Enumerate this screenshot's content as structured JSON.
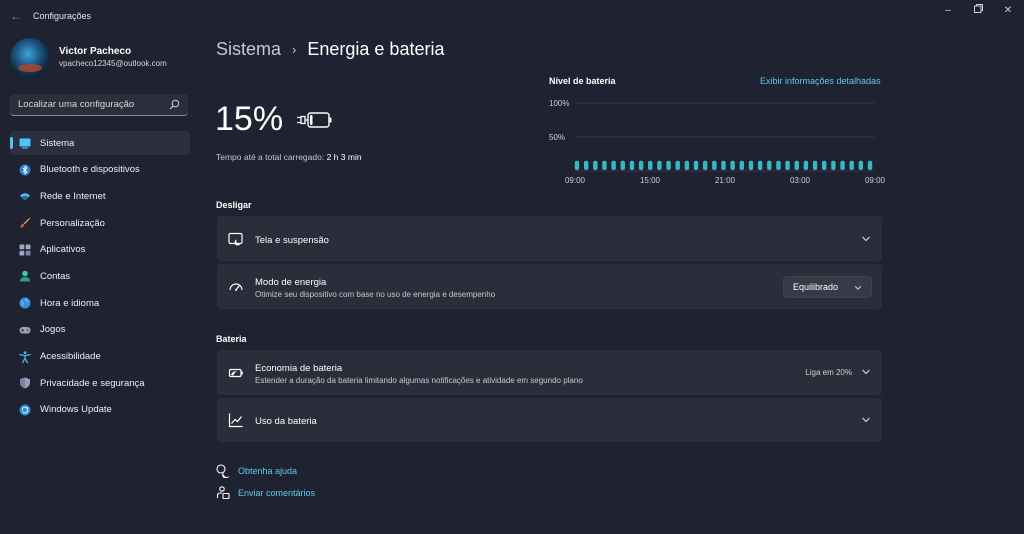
{
  "window": {
    "title": "Configurações",
    "back_icon": "back-arrow-icon",
    "minimize_icon": "minimize-icon",
    "restore_icon": "restore-icon",
    "close_icon": "close-icon"
  },
  "user": {
    "name": "Victor Pacheco",
    "email": "vpacheco12345@outlook.com"
  },
  "search": {
    "placeholder": "Localizar uma configuração",
    "icon": "search-icon"
  },
  "sidebar": {
    "items": [
      {
        "label": "Sistema",
        "icon": "monitor-icon",
        "active": true
      },
      {
        "label": "Bluetooth e dispositivos",
        "icon": "bluetooth-icon",
        "active": false
      },
      {
        "label": "Rede e Internet",
        "icon": "wifi-icon",
        "active": false
      },
      {
        "label": "Personalização",
        "icon": "brush-icon",
        "active": false
      },
      {
        "label": "Aplicativos",
        "icon": "apps-icon",
        "active": false
      },
      {
        "label": "Contas",
        "icon": "person-icon",
        "active": false
      },
      {
        "label": "Hora e idioma",
        "icon": "globe-clock-icon",
        "active": false
      },
      {
        "label": "Jogos",
        "icon": "gamepad-icon",
        "active": false
      },
      {
        "label": "Acessibilidade",
        "icon": "accessibility-icon",
        "active": false
      },
      {
        "label": "Privacidade e segurança",
        "icon": "shield-icon",
        "active": false
      },
      {
        "label": "Windows Update",
        "icon": "update-icon",
        "active": false
      }
    ]
  },
  "breadcrumb": {
    "parent": "Sistema",
    "separator": "›",
    "current": "Energia e bateria"
  },
  "battery": {
    "percent_label": "15%",
    "level": 0.15,
    "icon": "battery-charging-icon",
    "charge_time_label": "Tempo até a total carregado:",
    "charge_time_value": "2 h 3 min"
  },
  "chart_data": {
    "type": "bar",
    "title": "Nível de bateria",
    "link": "Exibir informações detalhadas",
    "y_ticks": [
      "100%",
      "50%"
    ],
    "ylim": [
      0,
      100
    ],
    "x_ticks": [
      "09:00",
      "15:00",
      "21:00",
      "03:00",
      "09:00"
    ],
    "values": [
      15,
      15,
      15,
      15,
      15,
      15,
      15,
      15,
      15,
      15,
      15,
      15,
      15,
      15,
      15,
      15,
      15,
      15,
      15,
      15,
      15,
      15,
      15,
      15,
      15,
      15,
      15,
      15,
      15,
      15,
      15,
      15,
      15
    ],
    "bar_color": "#3ab7c5",
    "grid": true
  },
  "sections": {
    "shutdown": {
      "label": "Desligar",
      "cards": [
        {
          "title": "Tela e suspensão",
          "icon": "screen-sleep-icon"
        },
        {
          "title": "Modo de energia",
          "subtitle": "Otimize seu dispositivo com base no uso de energia e desempenho",
          "icon": "power-mode-icon",
          "dropdown_value": "Equilibrado"
        }
      ]
    },
    "battery": {
      "label": "Bateria",
      "cards": [
        {
          "title": "Economia de bateria",
          "subtitle": "Estender a duração da bateria limitando algumas notificações e atividade em segundo plano",
          "icon": "battery-saver-icon",
          "status": "Liga em 20%"
        },
        {
          "title": "Uso da bateria",
          "icon": "chart-line-icon"
        }
      ]
    }
  },
  "footer": {
    "help": "Obtenha ajuda",
    "feedback": "Enviar comentários"
  },
  "colors": {
    "background": "#1f2230",
    "card": "#2a2d3a",
    "accent": "#4cc2ff",
    "link": "#62c8f0"
  }
}
